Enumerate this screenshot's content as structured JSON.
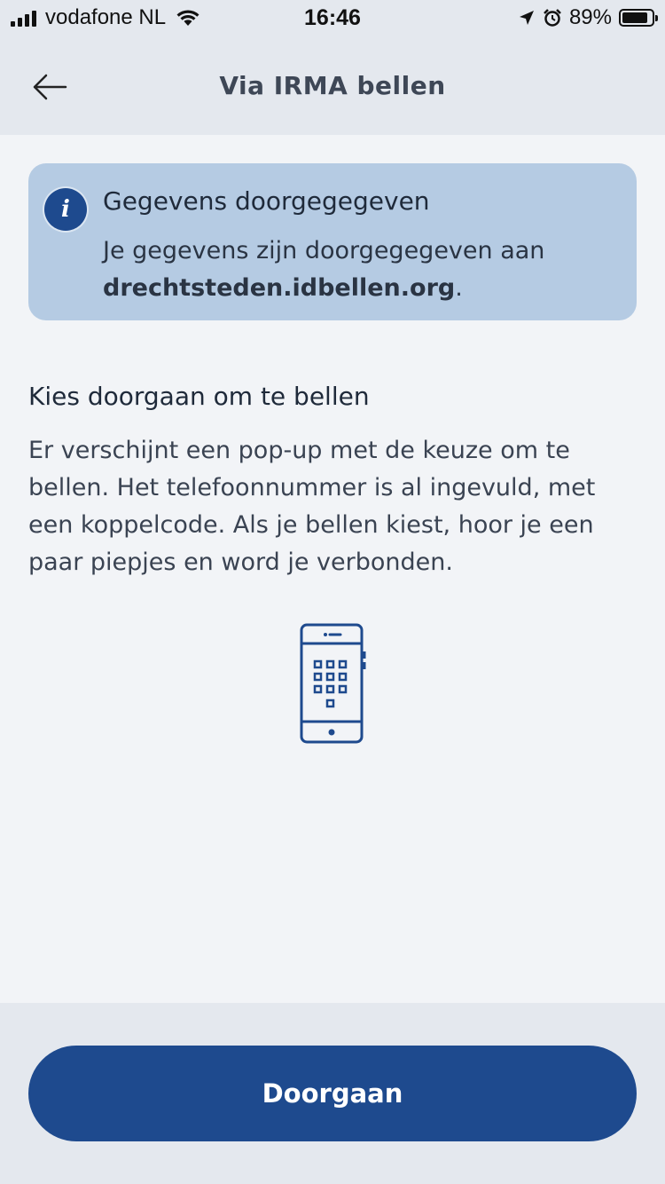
{
  "status_bar": {
    "carrier": "vodafone NL",
    "time": "16:46",
    "battery": "89%",
    "battery_level": 0.89
  },
  "header": {
    "title": "Via IRMA bellen",
    "back_icon": "arrow-left-icon"
  },
  "info_box": {
    "icon": "info-icon",
    "icon_glyph": "i",
    "title": "Gegevens doorgegegeven",
    "text_prefix": "Je gegevens zijn doorgegegeven aan",
    "domain": "drechtsteden.idbellen.org",
    "text_suffix": "."
  },
  "section": {
    "heading": "Kies doorgaan om te bellen",
    "body": "Er verschijnt een pop-up met de keuze om te bellen. Het telefoonnummer is al ingevuld, met een koppelcode. Als je bellen kiest, hoor je een paar piepjes en word je verbonden."
  },
  "illustration": {
    "icon": "phone-keypad-icon"
  },
  "footer": {
    "button_label": "Doorgaan"
  },
  "colors": {
    "primary": "#1e4a8e",
    "info_background": "#b5cbe3",
    "page_background": "#f2f4f7",
    "header_background": "#e4e8ee"
  }
}
